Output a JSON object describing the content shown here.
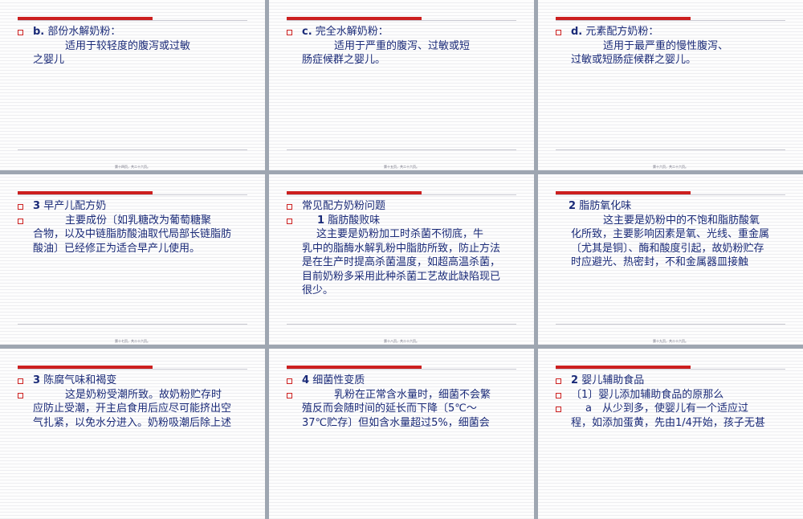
{
  "slides": [
    {
      "items": [
        {
          "prefix": "b.",
          "text": "部份水解奶粉：",
          "bullet": true
        },
        {
          "text": "适用于较轻度的腹泻或过敏",
          "indent": "ind"
        },
        {
          "text": "之婴儿"
        }
      ],
      "footer": "第十四页，共二十六页。"
    },
    {
      "items": [
        {
          "prefix": "c.",
          "text": "完全水解奶粉：",
          "bullet": true
        },
        {
          "text": "适用于严重的腹泻、过敏或短",
          "indent": "ind"
        },
        {
          "text": "肠症候群之婴儿。"
        }
      ],
      "footer": "第十五页，共二十六页。"
    },
    {
      "items": [
        {
          "prefix": "d.",
          "text": "元素配方奶粉：",
          "bullet": true
        },
        {
          "text": "适用于最严重的慢性腹泻、",
          "indent": "ind"
        },
        {
          "text": "过敏或短肠症候群之婴儿。"
        }
      ],
      "footer": "第十六页，共二十六页。"
    },
    {
      "items": [
        {
          "prefix": "3",
          "text": "早产儿配方奶",
          "bullet": true
        },
        {
          "text": "主要成份〔如乳糖改为葡萄糖聚",
          "bullet": true,
          "indent": "ind"
        },
        {
          "text": "合物，以及中链脂肪酸油取代局部长链脂肪"
        },
        {
          "text": "酸油〕已经修正为适合早产儿使用。"
        }
      ],
      "footer": "第十七页，共二十六页。"
    },
    {
      "items": [
        {
          "text": "常见配方奶粉问题",
          "bullet": true
        },
        {
          "prefix": "1",
          "text": "脂肪酸败味",
          "bullet": true,
          "indent": "lead"
        },
        {
          "text": "这主要是奶粉加工时杀菌不彻底，牛",
          "indent": "ind2"
        },
        {
          "text": "乳中的脂酶水解乳粉中脂肪所致，防止方法"
        },
        {
          "text": "是在生产时提高杀菌温度，如超高温杀菌，"
        },
        {
          "text": "目前奶粉多采用此种杀菌工艺故此缺陷现已"
        },
        {
          "text": "很少。"
        }
      ],
      "footer": "第十八页，共二十六页。"
    },
    {
      "items": [
        {
          "prefix": "2",
          "text": "脂肪氧化味",
          "bullet": false
        },
        {
          "text": "这主要是奶粉中的不饱和脂肪酸氧",
          "indent": "ind"
        },
        {
          "text": "化所致，主要影响因素是氧、光线、重金属"
        },
        {
          "text": "〔尤其是铜〕、酶和酸度引起，故奶粉贮存"
        },
        {
          "text": "时应避光、热密封，不和金属器皿接触"
        }
      ],
      "footer": "第十九页，共二十六页。"
    },
    {
      "items": [
        {
          "prefix": "3",
          "text": "陈腐气味和褐变",
          "bullet": true
        },
        {
          "text": "这是奶粉受潮所致。故奶粉贮存时",
          "bullet": true,
          "indent": "ind"
        },
        {
          "text": "应防止受潮，开主启食用后应尽可能挤出空"
        },
        {
          "text": "气扎紧，以免水分进入。奶粉吸潮后除上述"
        }
      ],
      "footer": ""
    },
    {
      "items": [
        {
          "prefix": "4",
          "text": "细菌性变质",
          "bullet": true
        },
        {
          "text": "乳粉在正常含水量时，细菌不会繁",
          "bullet": true,
          "indent": "ind"
        },
        {
          "text": "殖反而会随时间的延长而下降〔5℃～"
        },
        {
          "text": "37℃贮存〕但如含水量超过5%，细菌会"
        }
      ],
      "footer": ""
    },
    {
      "items": [
        {
          "prefix": "2",
          "text": "婴儿辅助食品",
          "bullet": true
        },
        {
          "text": "〔1〕婴儿添加辅助食品的原那么",
          "bullet": true
        },
        {
          "text": "a　从少到多，使婴儿有一个适应过",
          "bullet": true,
          "indent": "ind2"
        },
        {
          "text": "程，如添加蛋黄，先由1/4开始，孩子无甚"
        }
      ],
      "footer": ""
    }
  ]
}
